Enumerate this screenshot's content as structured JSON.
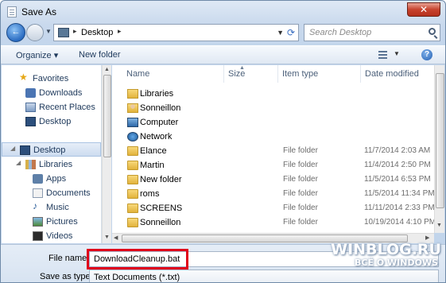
{
  "window": {
    "title": "Save As",
    "close_label": "✕"
  },
  "address": {
    "location": "Desktop"
  },
  "search": {
    "placeholder": "Search Desktop"
  },
  "toolbar": {
    "organize_label": "Organize ▾",
    "new_folder_label": "New folder",
    "help_label": "?"
  },
  "nav": {
    "favorites_label": "Favorites",
    "downloads_label": "Downloads",
    "recent_label": "Recent Places",
    "desktop_fav_label": "Desktop",
    "desktop_label": "Desktop",
    "libraries_label": "Libraries",
    "apps_label": "Apps",
    "documents_label": "Documents",
    "music_label": "Music",
    "pictures_label": "Pictures",
    "videos_label": "Videos"
  },
  "columns": {
    "name": "Name",
    "size": "Size",
    "type": "Item type",
    "date": "Date modified"
  },
  "files": [
    {
      "name": "Libraries",
      "type": "",
      "date": "",
      "icon": "library-icon"
    },
    {
      "name": "Sonneillon",
      "type": "",
      "date": "",
      "icon": "user-folder-icon"
    },
    {
      "name": "Computer",
      "type": "",
      "date": "",
      "icon": "computer-icon"
    },
    {
      "name": "Network",
      "type": "",
      "date": "",
      "icon": "network-icon"
    },
    {
      "name": "Elance",
      "type": "File folder",
      "date": "11/7/2014 2:03 AM",
      "icon": "folder-icon"
    },
    {
      "name": "Martin",
      "type": "File folder",
      "date": "11/4/2014 2:50 PM",
      "icon": "folder-icon"
    },
    {
      "name": "New folder",
      "type": "File folder",
      "date": "11/5/2014 6:53 PM",
      "icon": "folder-icon"
    },
    {
      "name": "roms",
      "type": "File folder",
      "date": "11/5/2014 11:34 PM",
      "icon": "folder-icon"
    },
    {
      "name": "SCREENS",
      "type": "File folder",
      "date": "11/11/2014 2:33 PM",
      "icon": "folder-icon"
    },
    {
      "name": "Sonneillon",
      "type": "File folder",
      "date": "10/19/2014 4:10 PM",
      "icon": "folder-icon"
    }
  ],
  "bottom": {
    "filename_label": "File name:",
    "filename_value": "DownloadCleanup.bat",
    "savetype_label": "Save as type:",
    "savetype_value": "Text Documents (*.txt)"
  },
  "watermark": {
    "line1": "WINBLOG.RU",
    "line2": "ВСЁ О WINDOWS"
  },
  "colors": {
    "highlight": "#e0001b",
    "accent": "#1e395b"
  }
}
